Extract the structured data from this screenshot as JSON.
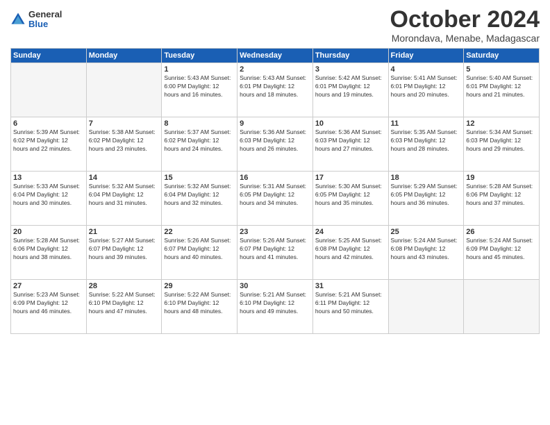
{
  "header": {
    "logo_general": "General",
    "logo_blue": "Blue",
    "month_title": "October 2024",
    "location": "Morondava, Menabe, Madagascar"
  },
  "weekdays": [
    "Sunday",
    "Monday",
    "Tuesday",
    "Wednesday",
    "Thursday",
    "Friday",
    "Saturday"
  ],
  "weeks": [
    [
      {
        "day": "",
        "info": ""
      },
      {
        "day": "",
        "info": ""
      },
      {
        "day": "1",
        "info": "Sunrise: 5:43 AM\nSunset: 6:00 PM\nDaylight: 12 hours\nand 16 minutes."
      },
      {
        "day": "2",
        "info": "Sunrise: 5:43 AM\nSunset: 6:01 PM\nDaylight: 12 hours\nand 18 minutes."
      },
      {
        "day": "3",
        "info": "Sunrise: 5:42 AM\nSunset: 6:01 PM\nDaylight: 12 hours\nand 19 minutes."
      },
      {
        "day": "4",
        "info": "Sunrise: 5:41 AM\nSunset: 6:01 PM\nDaylight: 12 hours\nand 20 minutes."
      },
      {
        "day": "5",
        "info": "Sunrise: 5:40 AM\nSunset: 6:01 PM\nDaylight: 12 hours\nand 21 minutes."
      }
    ],
    [
      {
        "day": "6",
        "info": "Sunrise: 5:39 AM\nSunset: 6:02 PM\nDaylight: 12 hours\nand 22 minutes."
      },
      {
        "day": "7",
        "info": "Sunrise: 5:38 AM\nSunset: 6:02 PM\nDaylight: 12 hours\nand 23 minutes."
      },
      {
        "day": "8",
        "info": "Sunrise: 5:37 AM\nSunset: 6:02 PM\nDaylight: 12 hours\nand 24 minutes."
      },
      {
        "day": "9",
        "info": "Sunrise: 5:36 AM\nSunset: 6:03 PM\nDaylight: 12 hours\nand 26 minutes."
      },
      {
        "day": "10",
        "info": "Sunrise: 5:36 AM\nSunset: 6:03 PM\nDaylight: 12 hours\nand 27 minutes."
      },
      {
        "day": "11",
        "info": "Sunrise: 5:35 AM\nSunset: 6:03 PM\nDaylight: 12 hours\nand 28 minutes."
      },
      {
        "day": "12",
        "info": "Sunrise: 5:34 AM\nSunset: 6:03 PM\nDaylight: 12 hours\nand 29 minutes."
      }
    ],
    [
      {
        "day": "13",
        "info": "Sunrise: 5:33 AM\nSunset: 6:04 PM\nDaylight: 12 hours\nand 30 minutes."
      },
      {
        "day": "14",
        "info": "Sunrise: 5:32 AM\nSunset: 6:04 PM\nDaylight: 12 hours\nand 31 minutes."
      },
      {
        "day": "15",
        "info": "Sunrise: 5:32 AM\nSunset: 6:04 PM\nDaylight: 12 hours\nand 32 minutes."
      },
      {
        "day": "16",
        "info": "Sunrise: 5:31 AM\nSunset: 6:05 PM\nDaylight: 12 hours\nand 34 minutes."
      },
      {
        "day": "17",
        "info": "Sunrise: 5:30 AM\nSunset: 6:05 PM\nDaylight: 12 hours\nand 35 minutes."
      },
      {
        "day": "18",
        "info": "Sunrise: 5:29 AM\nSunset: 6:05 PM\nDaylight: 12 hours\nand 36 minutes."
      },
      {
        "day": "19",
        "info": "Sunrise: 5:28 AM\nSunset: 6:06 PM\nDaylight: 12 hours\nand 37 minutes."
      }
    ],
    [
      {
        "day": "20",
        "info": "Sunrise: 5:28 AM\nSunset: 6:06 PM\nDaylight: 12 hours\nand 38 minutes."
      },
      {
        "day": "21",
        "info": "Sunrise: 5:27 AM\nSunset: 6:07 PM\nDaylight: 12 hours\nand 39 minutes."
      },
      {
        "day": "22",
        "info": "Sunrise: 5:26 AM\nSunset: 6:07 PM\nDaylight: 12 hours\nand 40 minutes."
      },
      {
        "day": "23",
        "info": "Sunrise: 5:26 AM\nSunset: 6:07 PM\nDaylight: 12 hours\nand 41 minutes."
      },
      {
        "day": "24",
        "info": "Sunrise: 5:25 AM\nSunset: 6:08 PM\nDaylight: 12 hours\nand 42 minutes."
      },
      {
        "day": "25",
        "info": "Sunrise: 5:24 AM\nSunset: 6:08 PM\nDaylight: 12 hours\nand 43 minutes."
      },
      {
        "day": "26",
        "info": "Sunrise: 5:24 AM\nSunset: 6:09 PM\nDaylight: 12 hours\nand 45 minutes."
      }
    ],
    [
      {
        "day": "27",
        "info": "Sunrise: 5:23 AM\nSunset: 6:09 PM\nDaylight: 12 hours\nand 46 minutes."
      },
      {
        "day": "28",
        "info": "Sunrise: 5:22 AM\nSunset: 6:10 PM\nDaylight: 12 hours\nand 47 minutes."
      },
      {
        "day": "29",
        "info": "Sunrise: 5:22 AM\nSunset: 6:10 PM\nDaylight: 12 hours\nand 48 minutes."
      },
      {
        "day": "30",
        "info": "Sunrise: 5:21 AM\nSunset: 6:10 PM\nDaylight: 12 hours\nand 49 minutes."
      },
      {
        "day": "31",
        "info": "Sunrise: 5:21 AM\nSunset: 6:11 PM\nDaylight: 12 hours\nand 50 minutes."
      },
      {
        "day": "",
        "info": ""
      },
      {
        "day": "",
        "info": ""
      }
    ]
  ]
}
